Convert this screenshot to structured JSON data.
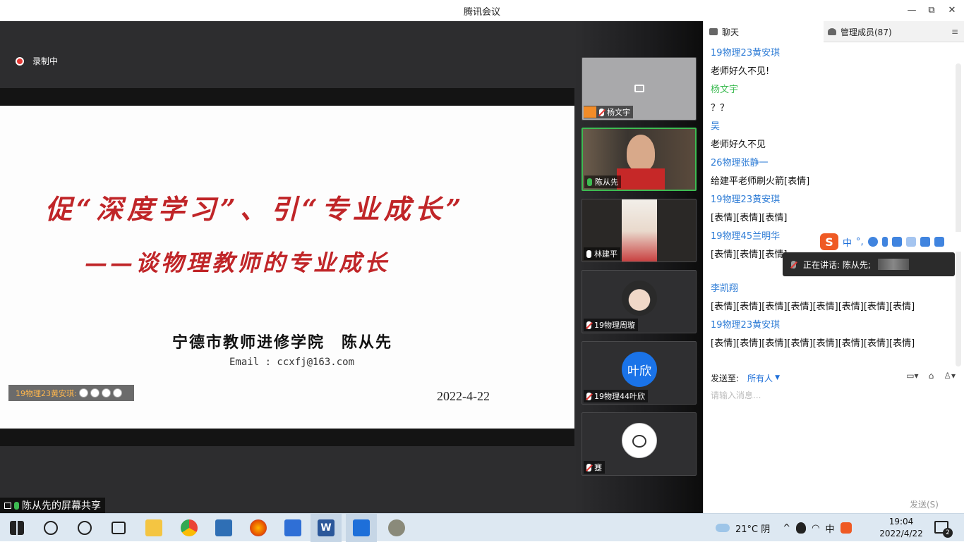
{
  "window": {
    "title": "腾讯会议",
    "minimize": "—",
    "maximize": "⧉",
    "close": "✕"
  },
  "recording": {
    "label": "录制中"
  },
  "slide": {
    "title": "促“深度学习”、引“专业成长”",
    "subtitle": "——谈物理教师的专业成长",
    "author": "宁德市教师进修学院　陈从先",
    "email": "Email : ccxfj@163.com",
    "date": "2022-4-22"
  },
  "reaction": {
    "text": "19物理23黄安琪:"
  },
  "share": {
    "label": "陈从先的屏幕共享"
  },
  "participants": [
    {
      "name": "杨文宇",
      "mic": "muted",
      "video": false
    },
    {
      "name": "陈从先",
      "mic": "speaking",
      "video": true
    },
    {
      "name": "林建平",
      "mic": "on",
      "video": true
    },
    {
      "name": "19物理周璇",
      "mic": "muted",
      "video": false
    },
    {
      "name": "19物理44叶欣",
      "mic": "muted",
      "video": false,
      "avatar_text": "叶欣"
    },
    {
      "name": "蹇",
      "mic": "muted",
      "video": false
    }
  ],
  "chat": {
    "tab_chat": "聊天",
    "tab_members": "管理成员(87)",
    "menu": "≡",
    "messages": [
      {
        "sender": "19物理23黄安琪",
        "text": "老师好久不见!"
      },
      {
        "sender": "杨文宇",
        "text": "？？",
        "sender_color": "green"
      },
      {
        "sender": "吴",
        "text": "老师好久不见"
      },
      {
        "sender": "26物理张静一",
        "text": "给建平老师刷火箭[表情]"
      },
      {
        "sender": "19物理23黄安琪",
        "text": "[表情][表情][表情]"
      },
      {
        "sender": "19物理45兰明华",
        "text": "[表情][表情][表情]"
      },
      {
        "sender": "李凯翔",
        "text": "[表情][表情][表情][表情][表情][表情][表情][表情]"
      },
      {
        "sender": "19物理23黄安琪",
        "text": "[表情][表情][表情][表情][表情][表情][表情][表情]"
      }
    ],
    "send_to_label": "发送至:",
    "send_to_value": "所有人",
    "input_placeholder": "请输入消息...",
    "send_button": "发送(S)"
  },
  "ime": {
    "logo": "S",
    "mode": "中",
    "punct": "°,"
  },
  "speaking_indicator": {
    "text": "正在讲话: 陈从先;"
  },
  "taskbar": {
    "weather": "21°C  阴",
    "ime_lang": "中",
    "time": "19:04",
    "date": "2022/4/22",
    "notifications": "2"
  },
  "colors": {
    "slide_title": "#c02528",
    "speaking_border": "#3dbb52",
    "link_blue": "#2e7cd6",
    "stage_bg": "#2d2d2f"
  }
}
